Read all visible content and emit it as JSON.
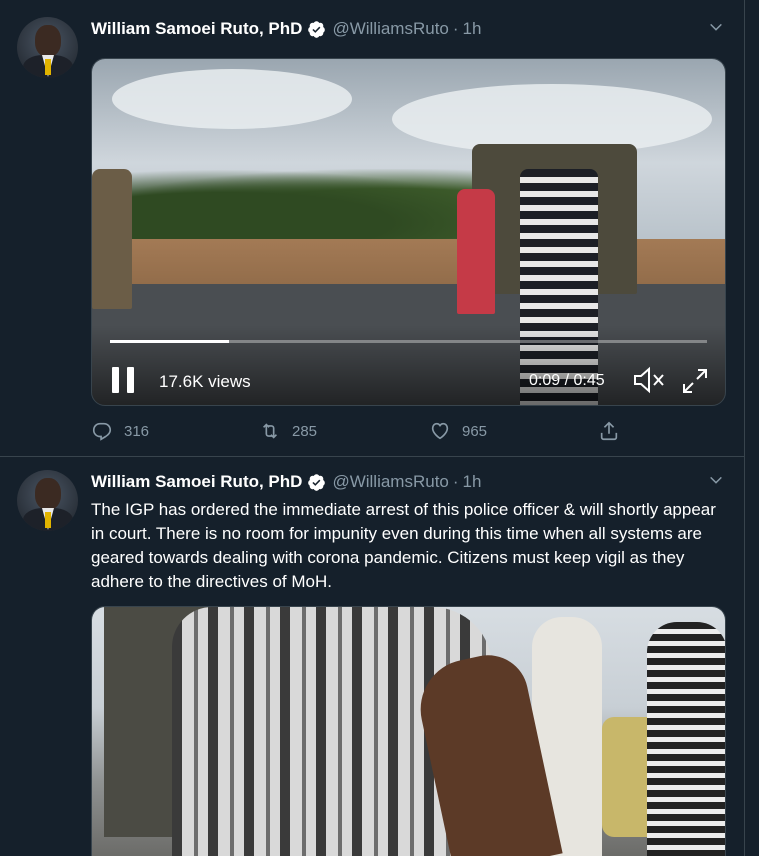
{
  "tweets": [
    {
      "author_name": "William Samoei Ruto, PhD",
      "handle": "@WilliamsRuto",
      "separator": "·",
      "time": "1h",
      "video": {
        "views": "17.6K views",
        "time_display": "0:09 / 0:45",
        "progress_fraction": 0.2
      },
      "stats": {
        "replies": "316",
        "retweets": "285",
        "likes": "965"
      }
    },
    {
      "author_name": "William Samoei Ruto, PhD",
      "handle": "@WilliamsRuto",
      "separator": "·",
      "time": "1h",
      "text": "The IGP has ordered the immediate arrest of this police officer & will shortly appear in court. There is no room for impunity even during this time when all systems are geared towards dealing with corona pandemic. Citizens must keep vigil as they adhere to the directives of MoH."
    }
  ],
  "icons": {
    "verified": "verified-badge-icon",
    "caret": "chevron-down-icon",
    "pause": "pause-icon",
    "mute": "speaker-muted-icon",
    "expand": "fullscreen-icon",
    "reply": "reply-icon",
    "retweet": "retweet-icon",
    "like": "heart-icon",
    "share": "share-icon"
  },
  "colors": {
    "background": "#15202b",
    "border": "#38444d",
    "secondary_text": "#8899a6",
    "verified": "#ffffff"
  }
}
